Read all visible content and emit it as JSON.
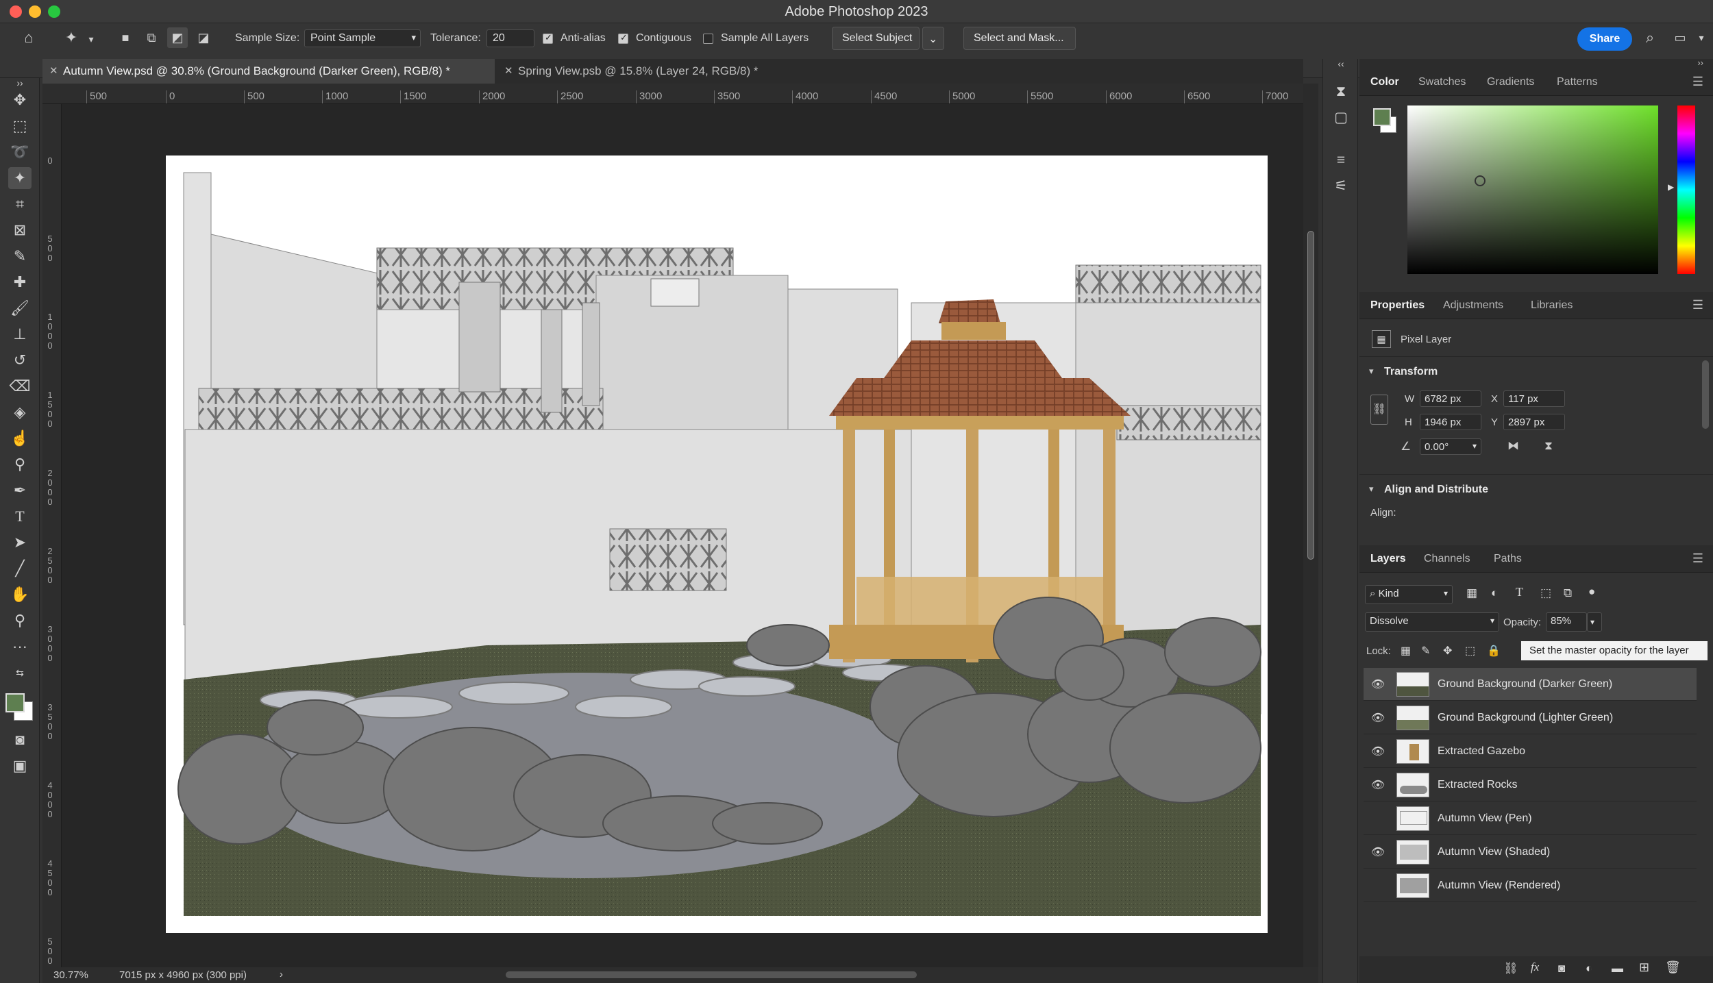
{
  "window": {
    "title": "Adobe Photoshop 2023"
  },
  "options_bar": {
    "sample_size_label": "Sample Size:",
    "sample_size_value": "Point Sample",
    "tolerance_label": "Tolerance:",
    "tolerance_value": "20",
    "anti_alias_label": "Anti-alias",
    "contiguous_label": "Contiguous",
    "sample_all_layers_label": "Sample All Layers",
    "select_subject_label": "Select Subject",
    "select_and_mask_label": "Select and Mask...",
    "share_label": "Share"
  },
  "tabs": [
    {
      "label": "Autumn View.psd @ 30.8% (Ground Background (Darker Green), RGB/8) *"
    },
    {
      "label": "Spring View.psb @ 15.8% (Layer 24, RGB/8) *"
    }
  ],
  "ruler_h": [
    "500",
    "0",
    "500",
    "1000",
    "1500",
    "2000",
    "2500",
    "3000",
    "3500",
    "4000",
    "4500",
    "5000",
    "5500",
    "6000",
    "6500",
    "7000"
  ],
  "ruler_v": [
    "0",
    "500",
    "1000",
    "1500",
    "2000",
    "2500",
    "3000",
    "3500",
    "4000",
    "4500",
    "5000"
  ],
  "status_bar": {
    "zoom": "30.77%",
    "doc_info": "7015 px x 4960 px (300 ppi)"
  },
  "color_panel": {
    "tabs": [
      "Color",
      "Swatches",
      "Gradients",
      "Patterns"
    ],
    "foreground": "#5e7f50",
    "background": "#ffffff"
  },
  "properties_panel": {
    "tabs": [
      "Properties",
      "Adjustments",
      "Libraries"
    ],
    "layer_type": "Pixel Layer",
    "transform_label": "Transform",
    "w_label": "W",
    "w_value": "6782 px",
    "h_label": "H",
    "h_value": "1946 px",
    "x_label": "X",
    "x_value": "117 px",
    "y_label": "Y",
    "y_value": "2897 px",
    "angle_value": "0.00°",
    "align_label": "Align and Distribute",
    "align_sub": "Align:"
  },
  "layers_panel": {
    "tabs": [
      "Layers",
      "Channels",
      "Paths"
    ],
    "filter_kind": "Kind",
    "blend_mode": "Dissolve",
    "opacity_label": "Opacity:",
    "opacity_value": "85%",
    "lock_label": "Lock:",
    "tooltip": "Set the master opacity for the layer",
    "layers": [
      {
        "name": "Ground Background (Darker Green)",
        "visible": true,
        "selected": true
      },
      {
        "name": "Ground Background (Lighter Green)",
        "visible": true,
        "selected": false
      },
      {
        "name": "Extracted Gazebo",
        "visible": true,
        "selected": false
      },
      {
        "name": "Extracted Rocks",
        "visible": true,
        "selected": false
      },
      {
        "name": "Autumn View (Pen)",
        "visible": false,
        "selected": false
      },
      {
        "name": "Autumn View (Shaded)",
        "visible": true,
        "selected": false
      },
      {
        "name": "Autumn View (Rendered)",
        "visible": false,
        "selected": false
      }
    ]
  }
}
